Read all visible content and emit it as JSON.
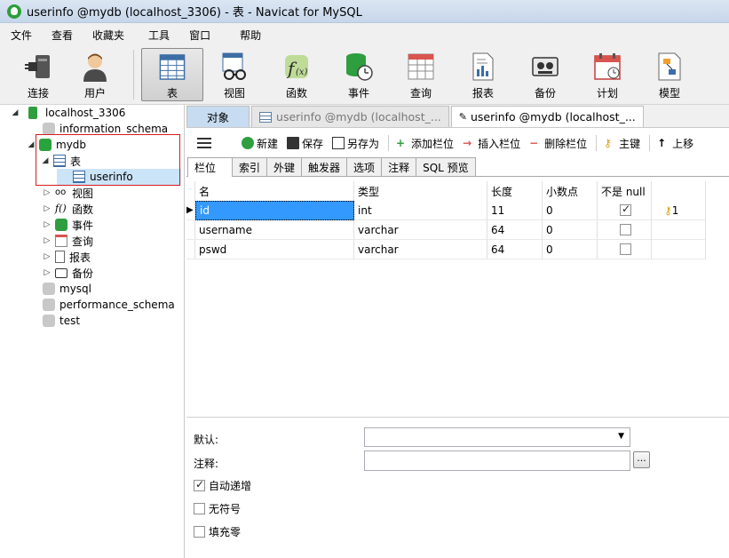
{
  "window": {
    "title": "userinfo @mydb (localhost_3306) - 表 - Navicat for MySQL"
  },
  "menu": [
    "文件",
    "查看",
    "收藏夹",
    "工具",
    "窗口",
    "帮助"
  ],
  "toolbar": {
    "connect": "连接",
    "user": "用户",
    "table": "表",
    "view": "视图",
    "function": "函数",
    "event": "事件",
    "query": "查询",
    "report": "报表",
    "backup": "备份",
    "schedule": "计划",
    "model": "模型"
  },
  "tree": {
    "connection": "localhost_3306",
    "databases": [
      "information_schema",
      "mydb",
      "mysql",
      "performance_schema",
      "test"
    ],
    "mydb_children": {
      "tables": "表",
      "table_item": "userinfo",
      "views": "视图",
      "functions": "函数",
      "events": "事件",
      "queries": "查询",
      "reports": "报表",
      "backups": "备份"
    }
  },
  "doc_tabs": {
    "object": "对象",
    "tab1": "userinfo @mydb (localhost_...",
    "tab2": "userinfo @mydb (localhost_..."
  },
  "inner_toolbar": {
    "new": "新建",
    "save": "保存",
    "save_as": "另存为",
    "add_field": "添加栏位",
    "insert_field": "插入栏位",
    "delete_field": "删除栏位",
    "primary_key": "主键",
    "move_up": "上移"
  },
  "sub_tabs": [
    "栏位",
    "索引",
    "外键",
    "触发器",
    "选项",
    "注释",
    "SQL 预览"
  ],
  "grid": {
    "headers": {
      "name": "名",
      "type": "类型",
      "length": "长度",
      "decimals": "小数点",
      "not_null": "不是 null",
      "key": ""
    },
    "rows": [
      {
        "name": "id",
        "type": "int",
        "length": "11",
        "decimals": "0",
        "not_null": true,
        "key": "1"
      },
      {
        "name": "username",
        "type": "varchar",
        "length": "64",
        "decimals": "0",
        "not_null": false,
        "key": ""
      },
      {
        "name": "pswd",
        "type": "varchar",
        "length": "64",
        "decimals": "0",
        "not_null": false,
        "key": ""
      }
    ]
  },
  "properties": {
    "default_label": "默认:",
    "comment_label": "注释:",
    "ellipsis": "...",
    "auto_increment": "自动递增",
    "unsigned": "无符号",
    "zerofill": "填充零"
  }
}
